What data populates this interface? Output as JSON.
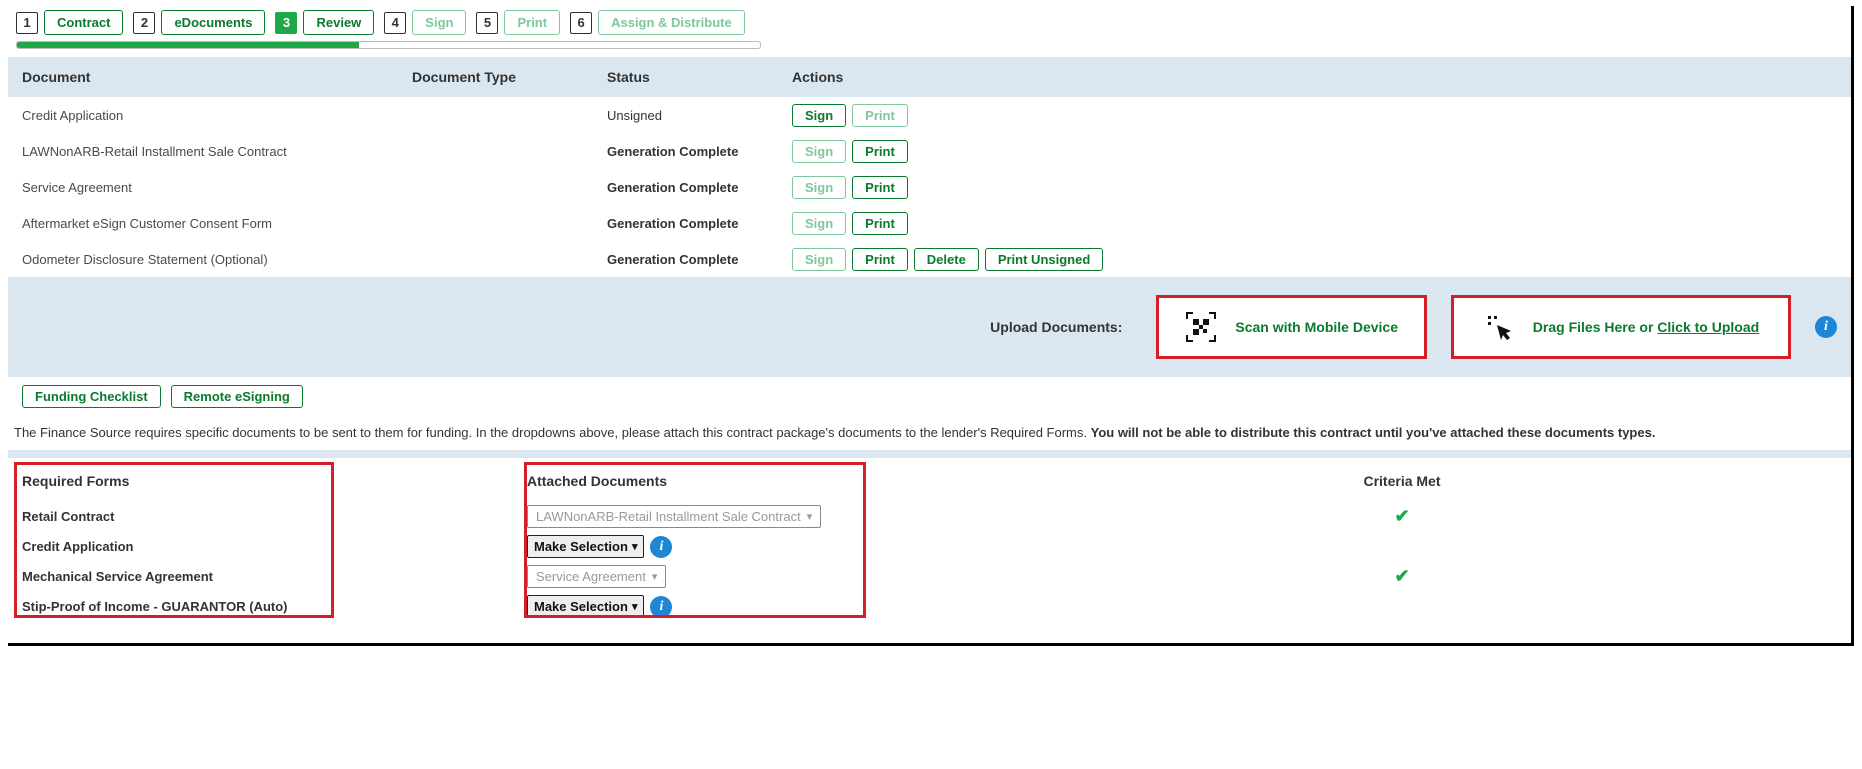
{
  "steps": [
    {
      "num": "1",
      "label": "Contract",
      "active": false,
      "disabled": false
    },
    {
      "num": "2",
      "label": "eDocuments",
      "active": false,
      "disabled": false
    },
    {
      "num": "3",
      "label": "Review",
      "active": true,
      "disabled": false
    },
    {
      "num": "4",
      "label": "Sign",
      "active": false,
      "disabled": true
    },
    {
      "num": "5",
      "label": "Print",
      "active": false,
      "disabled": true
    },
    {
      "num": "6",
      "label": "Assign & Distribute",
      "active": false,
      "disabled": true
    }
  ],
  "headers": {
    "document": "Document",
    "type": "Document Type",
    "status": "Status",
    "actions": "Actions"
  },
  "rows": [
    {
      "name": "Credit Application",
      "type": "",
      "status": "Unsigned",
      "status_class": "unsigned",
      "actions": [
        {
          "label": "Sign",
          "disabled": false
        },
        {
          "label": "Print",
          "disabled": true
        }
      ]
    },
    {
      "name": "LAWNonARB-Retail Installment Sale Contract",
      "type": "",
      "status": "Generation Complete",
      "status_class": "",
      "actions": [
        {
          "label": "Sign",
          "disabled": true
        },
        {
          "label": "Print",
          "disabled": false
        }
      ]
    },
    {
      "name": "Service Agreement",
      "type": "",
      "status": "Generation Complete",
      "status_class": "",
      "actions": [
        {
          "label": "Sign",
          "disabled": true
        },
        {
          "label": "Print",
          "disabled": false
        }
      ]
    },
    {
      "name": "Aftermarket eSign Customer Consent Form",
      "type": "",
      "status": "Generation Complete",
      "status_class": "",
      "actions": [
        {
          "label": "Sign",
          "disabled": true
        },
        {
          "label": "Print",
          "disabled": false
        }
      ]
    },
    {
      "name": "Odometer Disclosure Statement (Optional)",
      "type": "",
      "status": "Generation Complete",
      "status_class": "",
      "actions": [
        {
          "label": "Sign",
          "disabled": true
        },
        {
          "label": "Print",
          "disabled": false
        },
        {
          "label": "Delete",
          "disabled": false
        },
        {
          "label": "Print Unsigned",
          "disabled": false
        }
      ]
    }
  ],
  "upload": {
    "label": "Upload Documents:",
    "scan": "Scan with Mobile Device",
    "drag_prefix": "Drag Files Here or ",
    "drag_link": "Click to Upload"
  },
  "below_buttons": {
    "funding": "Funding Checklist",
    "remote": "Remote eSigning"
  },
  "instructions": {
    "text1": "The Finance Source requires specific documents to be sent to them for funding. In the dropdowns above, please attach this contract package's documents to the lender's Required Forms. ",
    "bold": "You will not be able to distribute this contract until you've attached these documents types."
  },
  "req": {
    "h1": "Required Forms",
    "h2": "Attached Documents",
    "h3": "Criteria Met",
    "rows": [
      {
        "form": "Retail Contract",
        "attached": "LAWNonARB-Retail Installment Sale Contract",
        "preset": true,
        "met": true
      },
      {
        "form": "Credit Application",
        "attached": "Make Selection",
        "preset": false,
        "met": false
      },
      {
        "form": "Mechanical Service Agreement",
        "attached": "Service Agreement",
        "preset": true,
        "met": true
      },
      {
        "form": "Stip-Proof of Income - GUARANTOR (Auto)",
        "attached": "Make Selection",
        "preset": false,
        "met": false
      }
    ]
  }
}
